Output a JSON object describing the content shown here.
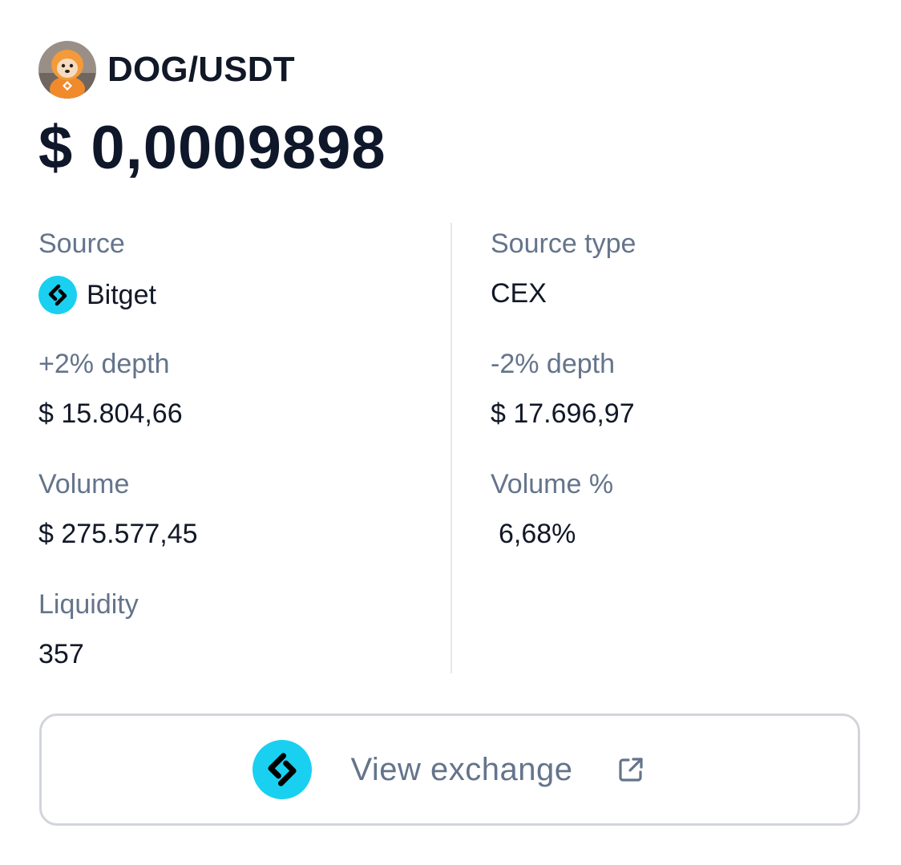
{
  "pair": {
    "name": "DOG/USDT",
    "avatar_icon": "dog-avatar-icon",
    "price": "$ 0,0009898"
  },
  "stats": {
    "source": {
      "label": "Source",
      "value": "Bitget",
      "icon": "bitget-logo-icon"
    },
    "source_type": {
      "label": "Source type",
      "value": "CEX"
    },
    "depth_plus": {
      "label": "+2% depth",
      "value": "$ 15.804,66"
    },
    "depth_minus": {
      "label": "-2% depth",
      "value": "$ 17.696,97"
    },
    "volume": {
      "label": "Volume",
      "value": "$ 275.577,45"
    },
    "volume_pct": {
      "label": "Volume %",
      "value": "6,68%"
    },
    "liquidity": {
      "label": "Liquidity",
      "value": "357"
    }
  },
  "action": {
    "label": "View exchange",
    "icon": "bitget-logo-icon",
    "trailing_icon": "external-link-icon"
  },
  "colors": {
    "bitget_brand": "#19d0f0",
    "label_text": "#64748b",
    "value_text": "#111827"
  }
}
